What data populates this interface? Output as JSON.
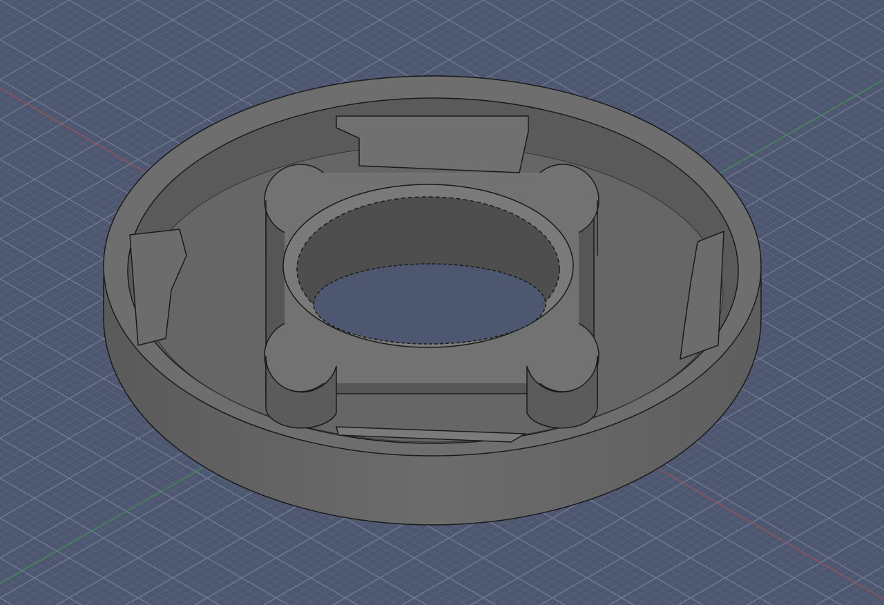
{
  "viewport": {
    "background_color": "#4d5870",
    "grid_minor_color": "#5f6a80",
    "grid_major_color": "#75809a",
    "x_axis_color": "#b04848",
    "y_axis_color": "#3f9a4a",
    "part_color": "#6a6a6a",
    "edge_color": "#1a1a1a"
  }
}
